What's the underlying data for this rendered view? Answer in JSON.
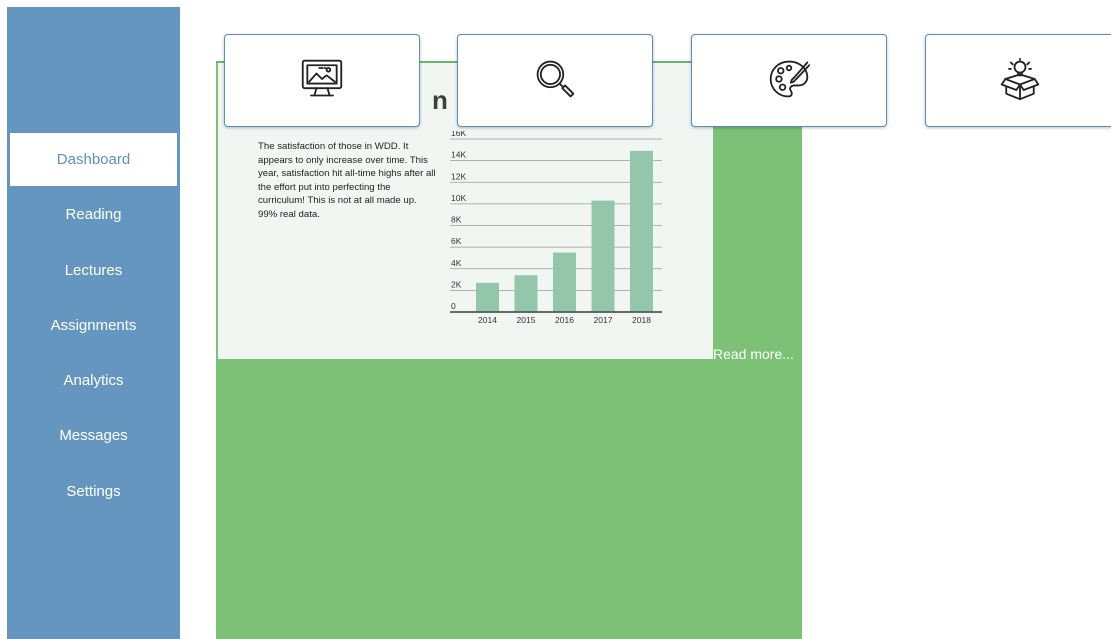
{
  "sidebar": {
    "items": [
      {
        "label": "Dashboard",
        "active": true
      },
      {
        "label": "Reading"
      },
      {
        "label": "Lectures"
      },
      {
        "label": "Assignments"
      },
      {
        "label": "Analytics"
      },
      {
        "label": "Messages"
      },
      {
        "label": "Settings"
      }
    ]
  },
  "tiles": [
    {
      "icon": "monitor-image-icon"
    },
    {
      "icon": "magnifier-icon"
    },
    {
      "icon": "palette-icon"
    },
    {
      "icon": "idea-box-icon"
    }
  ],
  "card": {
    "title_visible": "n R",
    "description": "The satisfaction of those in WDD. It appears to only increase over time. This year, satisfaction hit all-time highs after all the effort put into perfecting the curriculum! This is not at all made up. 99% real data.",
    "read_more": "Read more..."
  },
  "colors": {
    "sidebar": "#6596c0",
    "card": "#7dc177",
    "bar": "#93c6ab",
    "tile_border": "#5b8dbd"
  },
  "chart_data": {
    "type": "bar",
    "categories": [
      "2014",
      "2015",
      "2016",
      "2017",
      "2018"
    ],
    "values": [
      2700,
      3400,
      5500,
      10300,
      14900
    ],
    "y_ticks": [
      "0",
      "2K",
      "4K",
      "6K",
      "8K",
      "10K",
      "12K",
      "14K",
      "16K"
    ],
    "ylim": [
      0,
      16000
    ],
    "grid": true,
    "legend": "none"
  }
}
